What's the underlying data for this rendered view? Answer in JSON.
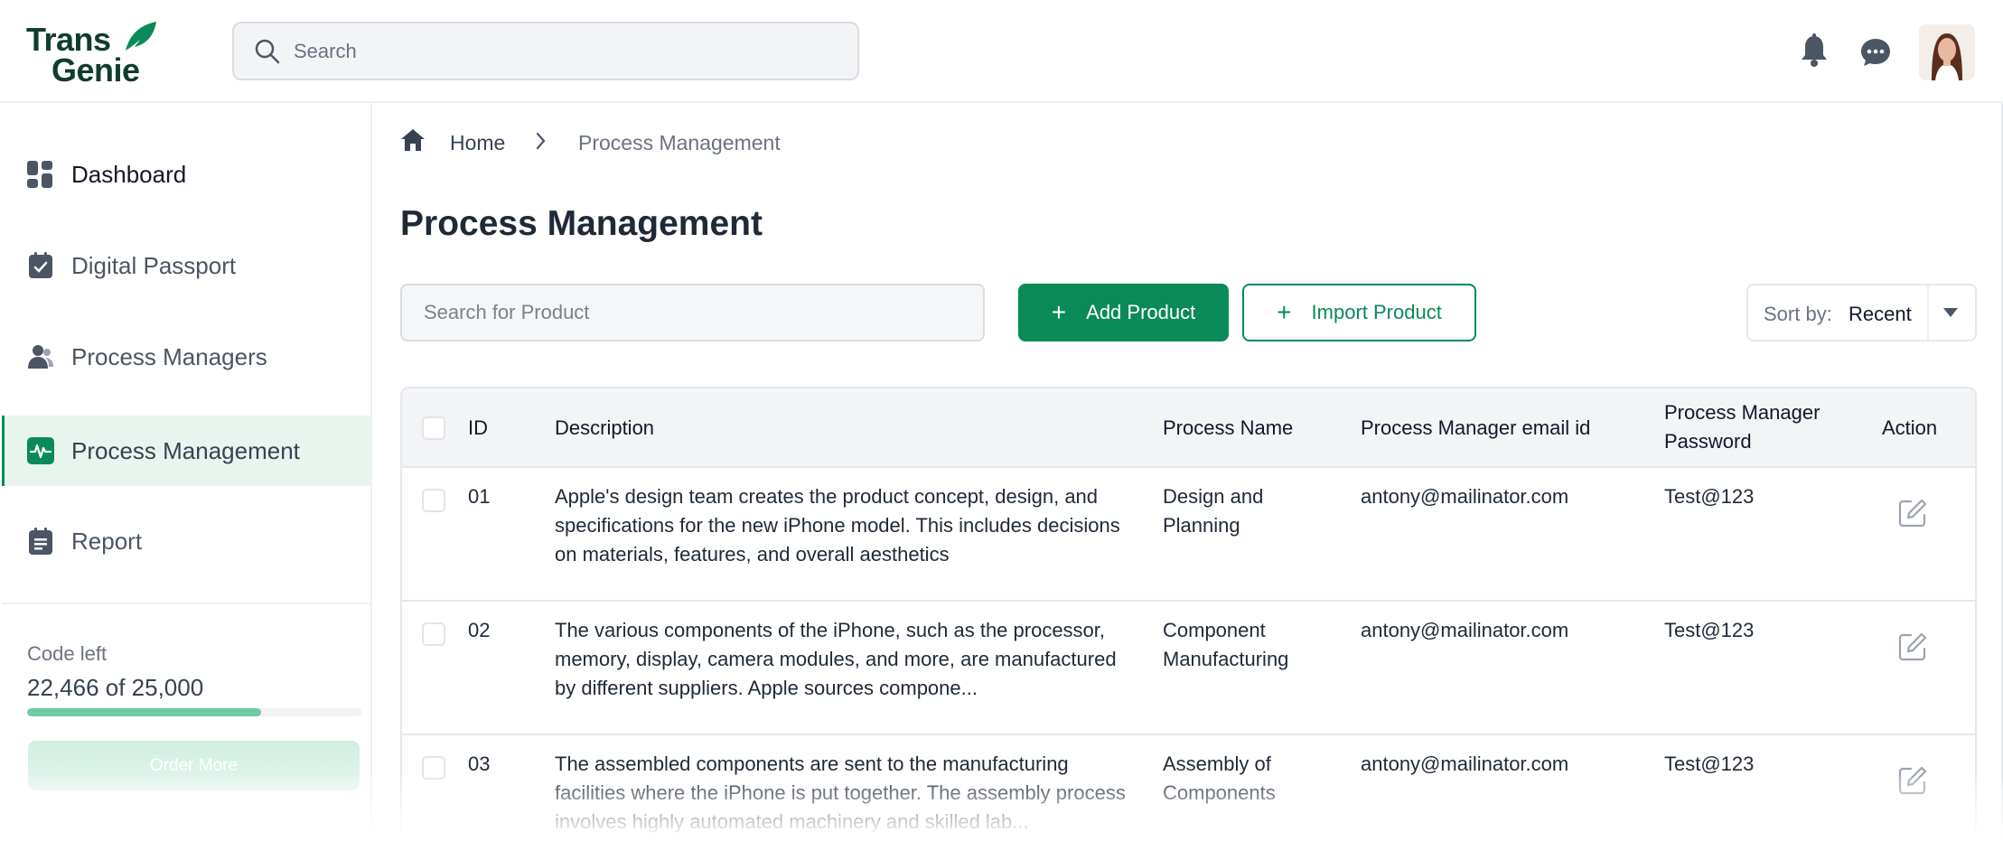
{
  "brand": {
    "line1": "Trans",
    "line2": "Genie",
    "color": "#0f3d2e",
    "accent": "#0a8a58"
  },
  "header": {
    "search_placeholder": "Search",
    "icons": [
      "search-icon",
      "bell-icon",
      "chat-icon",
      "avatar"
    ]
  },
  "sidebar": {
    "items": [
      {
        "label": "Dashboard",
        "icon": "dashboard-icon",
        "active": false
      },
      {
        "label": "Digital Passport",
        "icon": "passport-icon",
        "active": false
      },
      {
        "label": "Process Managers",
        "icon": "users-icon",
        "active": false
      },
      {
        "label": "Process Management",
        "icon": "process-icon",
        "active": true
      },
      {
        "label": "Report",
        "icon": "report-icon",
        "active": false
      }
    ],
    "code_left_label": "Code left",
    "code_left_value": "22,466 of 25,000",
    "code_progress": 0.7,
    "order_button": "Order More"
  },
  "breadcrumb": {
    "home": "Home",
    "current": "Process Management"
  },
  "page": {
    "title": "Process Management",
    "product_search_placeholder": "Search for Product",
    "add_button": "Add Product",
    "import_button": "Import Product",
    "sort_label": "Sort by:",
    "sort_value": "Recent"
  },
  "table": {
    "columns": {
      "id": "ID",
      "description": "Description",
      "process_name": "Process Name",
      "email": "Process Manager email id",
      "password_line1": "Process Manager",
      "password_line2": "Password",
      "action": "Action"
    },
    "rows": [
      {
        "id": "01",
        "description": "Apple's design team creates the product concept, design, and specifications for the new iPhone model. This includes decisions on materials, features, and overall aesthetics",
        "process_name": "Design and Planning",
        "email": "antony@mailinator.com",
        "password": "Test@123"
      },
      {
        "id": "02",
        "description": "The various components of the iPhone, such as the processor, memory, display, camera modules, and more, are manufactured by different suppliers. Apple sources compone...",
        "process_name": "Component Manufacturing",
        "email": "antony@mailinator.com",
        "password": "Test@123"
      },
      {
        "id": "03",
        "description": "The assembled components are sent to the manufacturing facilities where the iPhone is put together. The assembly process involves highly automated machinery and skilled lab...",
        "process_name": "Assembly of Components",
        "email": "antony@mailinator.com",
        "password": "Test@123"
      }
    ]
  }
}
